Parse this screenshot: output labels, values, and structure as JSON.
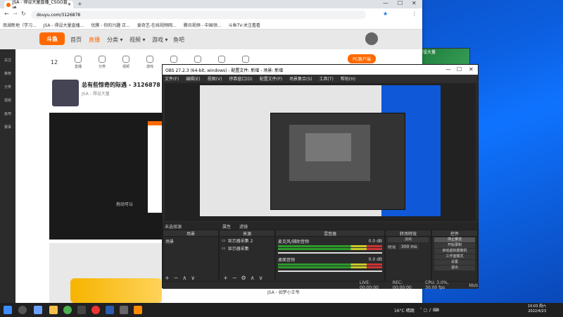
{
  "browser": {
    "tab_title": "JSA - 得设大量直播_CSGO直播",
    "url": "douyu.com/3126878",
    "bookmarks": [
      "南湖新地（学习...",
      "JSA - 得设大量直播...",
      "优腾 - 你的兴趣 正...",
      "爱奇艺-在线视频网...",
      "腾讯视频 - 中国领...",
      "斗鱼TV-关注看看"
    ]
  },
  "douyu": {
    "logo": "斗鱼",
    "nav": [
      "首页",
      "直播",
      "分类 ▾",
      "视频 ▾",
      "游戏 ▾",
      "鱼吧"
    ],
    "left_items": [
      "关注",
      "推荐",
      "分类",
      "视频",
      "鱼吧",
      "赛事"
    ],
    "cat_count": "12",
    "cat_labels": [
      "直播",
      "分类",
      "视频",
      "游戏",
      "鱼吧",
      "赛事",
      "活动",
      "更多"
    ],
    "pc_button": "PC客户端",
    "room_title": "总有些惊奇的际遇 - 3126878",
    "room_meta": "JSA - 得设大量",
    "player_text": "拖动可以",
    "chat_text": "JSA - 如梦小王爷"
  },
  "obs": {
    "title": "OBS 27.2.3 (64-bit, windows) - 配置文件: 新增 - 场景: 新增",
    "menu": [
      "文件(F)",
      "编辑(E)",
      "视图(V)",
      "停靠窗口(D)",
      "配置文件(P)",
      "场景集合(S)",
      "工具(T)",
      "帮助(H)"
    ],
    "no_source": "未选择源",
    "toolbar": [
      "属性",
      "滤镜"
    ],
    "docks": {
      "scenes": "场景",
      "sources": "来源",
      "mixer": "混音器",
      "transitions": "转场特效",
      "controls": "控件"
    },
    "scene_items": [
      "场景"
    ],
    "source_items": [
      "显示器采集 2",
      "显示器采集"
    ],
    "mixer": [
      {
        "name": "麦克风/辅助音频",
        "db": "0.0 dB"
      },
      {
        "name": "桌面音频",
        "db": "0.0 dB"
      }
    ],
    "transition": {
      "type": "淡出",
      "duration_label": "时长",
      "duration": "300 ms"
    },
    "controls": [
      "停止推流",
      "开始录制",
      "启动虚拟摄像机",
      "工作室模式",
      "设置",
      "退出"
    ],
    "status": {
      "live": "LIVE: 00:00:00",
      "rec": "REC: 00:00:00",
      "cpu": "CPU: 3.0%, 30.00 fps",
      "kbps": "kb/s"
    }
  },
  "desktop": {
    "thumb_label": "得设大量"
  },
  "taskbar": {
    "weather": "16°C 晴朗",
    "time": "10:03 周六",
    "date": "2022/4/23"
  },
  "colors": {
    "douyu_orange": "#ff6a00",
    "desktop_blue": "#0c5fe0",
    "obs_dark": "#2b2b2b"
  }
}
